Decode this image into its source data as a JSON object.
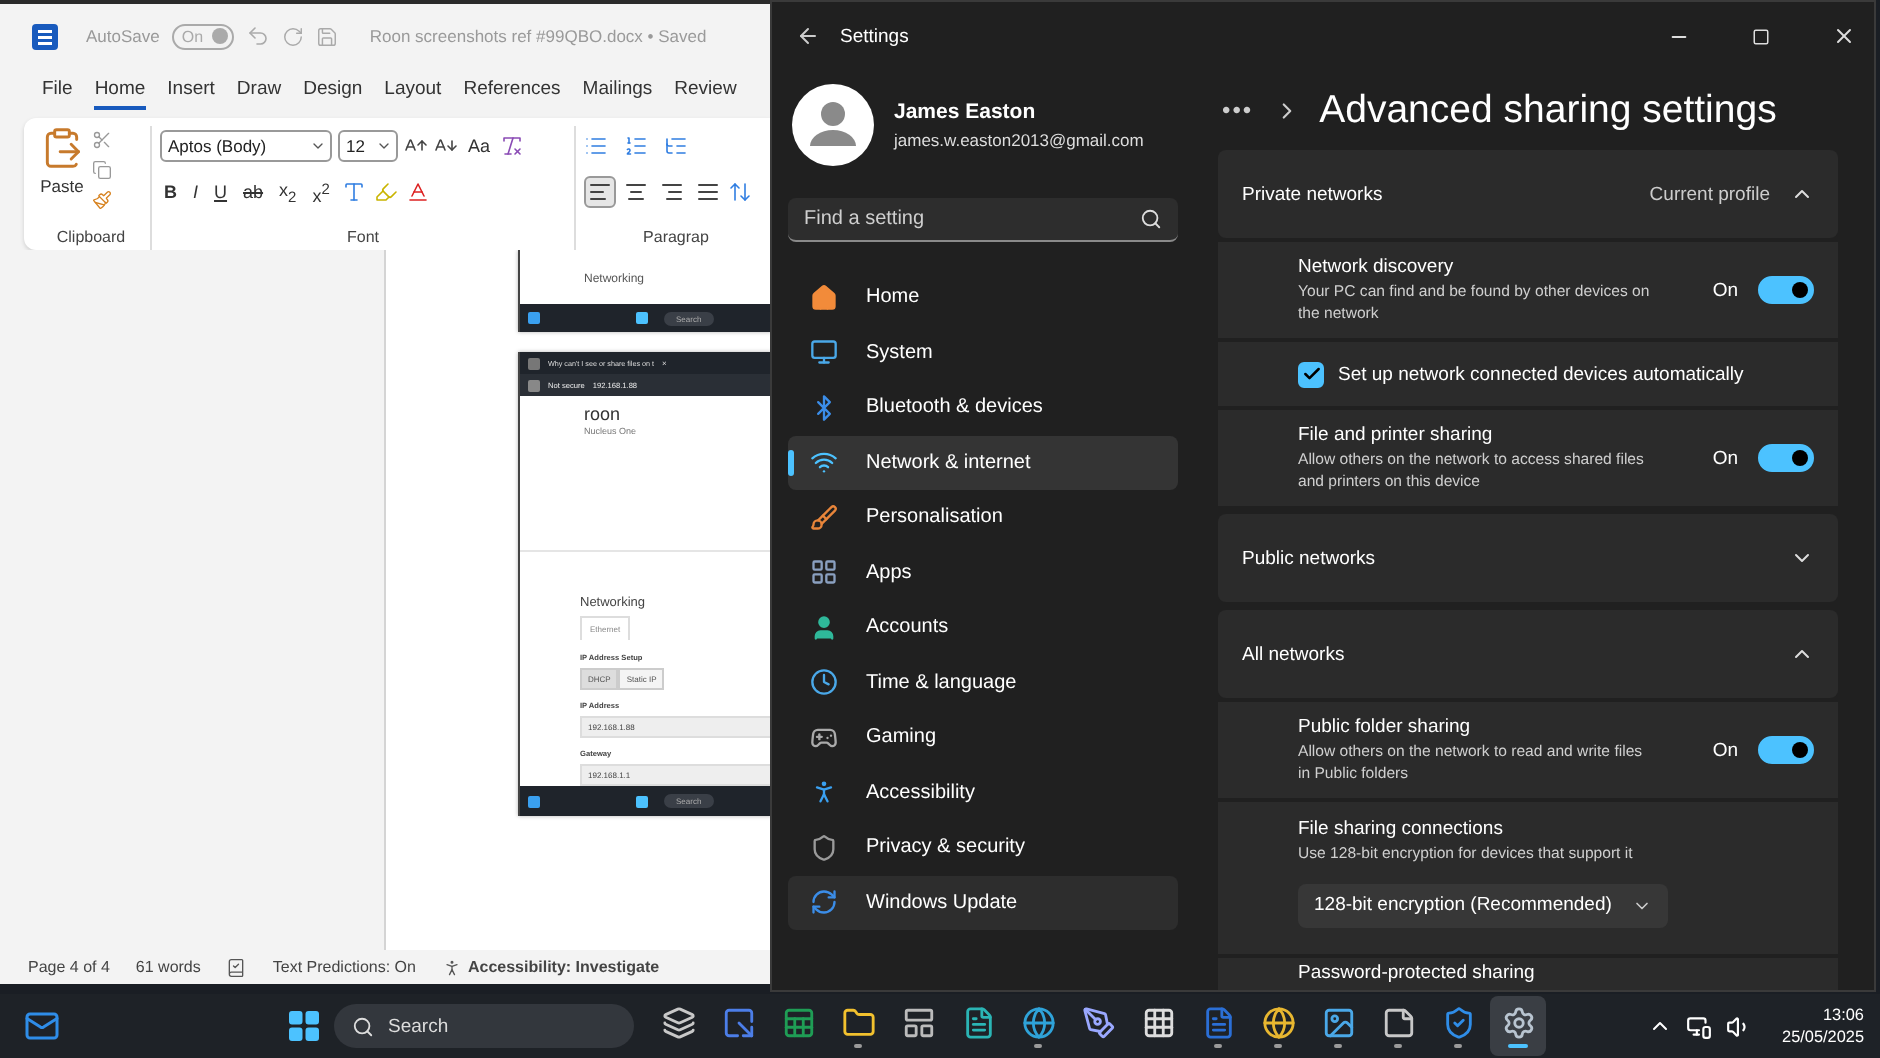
{
  "word": {
    "title_bar": {
      "autosave_label": "AutoSave",
      "autosave": {
        "label": "On",
        "on": true
      },
      "document_title": "Roon  screenshots ref #99QBO.docx • Saved"
    },
    "menu_tabs": [
      {
        "label": "File",
        "selected": false
      },
      {
        "label": "Home",
        "selected": true
      },
      {
        "label": "Insert",
        "selected": false
      },
      {
        "label": "Draw",
        "selected": false
      },
      {
        "label": "Design",
        "selected": false
      },
      {
        "label": "Layout",
        "selected": false
      },
      {
        "label": "References",
        "selected": false
      },
      {
        "label": "Mailings",
        "selected": false
      },
      {
        "label": "Review",
        "selected": false
      }
    ],
    "ribbon": {
      "paste_label": "Paste",
      "font_name": "Aptos (Body)",
      "font_size": "12",
      "change_case": "Aa",
      "format_buttons": [
        "B",
        "I",
        "U",
        "ab",
        "x$_{2}$",
        "x$^{2}$"
      ],
      "alignments": [
        {
          "selected": true
        },
        {
          "selected": false
        },
        {
          "selected": false
        },
        {
          "selected": false
        }
      ],
      "group_labels": [
        "Clipboard",
        "Font",
        "Paragrap"
      ]
    },
    "document": {
      "screenshot_top": {
        "heading": "Networking",
        "taskbar_search": "Search"
      },
      "screenshot_main": {
        "tab_title": "Why can't I see or share files on t",
        "tab_close": "×",
        "address_warning": "Not secure",
        "address": "192.168.1.88",
        "logo": "roon",
        "device": "Nucleus One",
        "heading": "Networking",
        "tab": "Ethernet",
        "setup_label": "IP Address Setup",
        "setup_options": [
          {
            "label": "DHCP",
            "selected": true
          },
          {
            "label": "Static IP",
            "selected": false
          }
        ],
        "fields": [
          {
            "label": "IP Address",
            "value": "192.168.1.88"
          },
          {
            "label": "Gateway",
            "value": "192.168.1.1"
          }
        ],
        "taskbar_search": "Search"
      }
    },
    "status_bar": {
      "page": "Page 4 of 4",
      "words": "61 words",
      "predictions": "Text Predictions: On",
      "accessibility": "Accessibility: Investigate"
    }
  },
  "settings": {
    "title": "Settings",
    "user": {
      "name": "James Easton",
      "email": "james.w.easton2013@gmail.com"
    },
    "search": {
      "placeholder": "Find a setting"
    },
    "nav": [
      {
        "label": "Home",
        "selected": false,
        "hovered": false
      },
      {
        "label": "System",
        "selected": false,
        "hovered": false
      },
      {
        "label": "Bluetooth & devices",
        "selected": false,
        "hovered": false
      },
      {
        "label": "Network & internet",
        "selected": true,
        "hovered": false
      },
      {
        "label": "Personalisation",
        "selected": false,
        "hovered": false
      },
      {
        "label": "Apps",
        "selected": false,
        "hovered": false
      },
      {
        "label": "Accounts",
        "selected": false,
        "hovered": false
      },
      {
        "label": "Time & language",
        "selected": false,
        "hovered": false
      },
      {
        "label": "Gaming",
        "selected": false,
        "hovered": false
      },
      {
        "label": "Accessibility",
        "selected": false,
        "hovered": false
      },
      {
        "label": "Privacy & security",
        "selected": false,
        "hovered": false
      },
      {
        "label": "Windows Update",
        "selected": false,
        "hovered": true
      }
    ],
    "breadcrumb_more": "•••",
    "page_title": "Advanced sharing settings",
    "sections": [
      {
        "title": "Private networks",
        "tag": "Current profile",
        "expanded": true,
        "items": [
          {
            "kind": "toggle",
            "title": "Network discovery",
            "description": "Your PC can find and be found by other devices on the network",
            "state_label": "On",
            "on": true
          },
          {
            "kind": "checkbox",
            "label": "Set up network connected devices automatically",
            "checked": true
          },
          {
            "kind": "toggle",
            "title": "File and printer sharing",
            "description": "Allow others on the network to access shared files and printers on this device",
            "state_label": "On",
            "on": true
          }
        ]
      },
      {
        "title": "Public networks",
        "expanded": false
      },
      {
        "title": "All networks",
        "expanded": true,
        "items": [
          {
            "kind": "toggle",
            "title": "Public folder sharing",
            "description": "Allow others on the network to read and write files in Public folders",
            "state_label": "On",
            "on": true
          },
          {
            "kind": "dropdown",
            "title": "File sharing connections",
            "description": "Use 128-bit encryption for devices that support it",
            "value": "128-bit encryption (Recommended)"
          },
          {
            "kind": "label",
            "title": "Password-protected sharing"
          }
        ]
      }
    ]
  },
  "taskbar": {
    "search": "Search",
    "apps": [
      {
        "running": false,
        "active": false
      },
      {
        "running": false,
        "active": false
      },
      {
        "running": false,
        "active": false
      },
      {
        "running": true,
        "active": false
      },
      {
        "running": false,
        "active": false
      },
      {
        "running": false,
        "active": false
      },
      {
        "running": true,
        "active": false
      },
      {
        "running": false,
        "active": false
      },
      {
        "running": false,
        "active": false
      },
      {
        "running": true,
        "active": false
      },
      {
        "running": true,
        "active": false
      },
      {
        "running": true,
        "active": false
      },
      {
        "running": true,
        "active": false
      },
      {
        "running": true,
        "active": false
      },
      {
        "running": true,
        "active": true
      }
    ],
    "time": "13:06",
    "date": "25/05/2025"
  }
}
